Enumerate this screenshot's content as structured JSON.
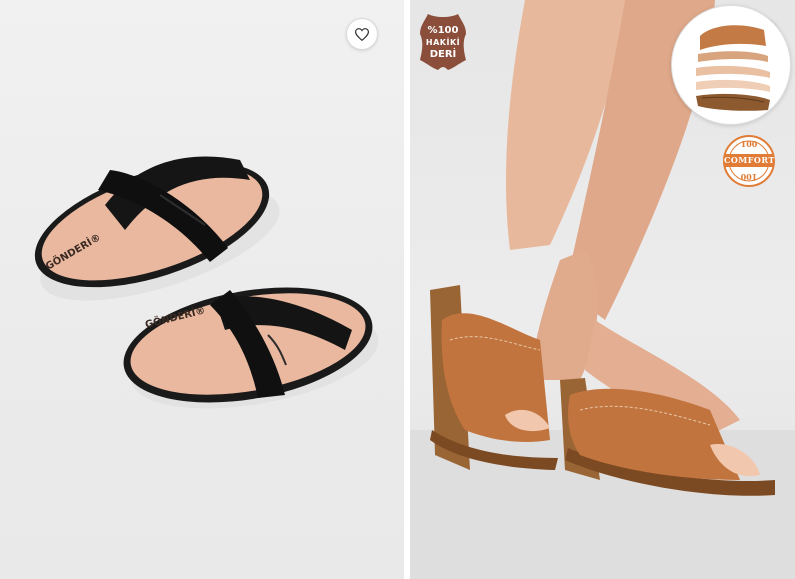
{
  "products": [
    {
      "id_label": "left-card",
      "image_alt": "Black cross-strap flat slide sandals",
      "brand_on_insole": "GÖNDERİ®",
      "favorite_icon": "heart-icon",
      "colors": {
        "strap": "#161616",
        "insole": "#eab9a0",
        "sole": "#1c1c1c"
      }
    },
    {
      "id_label": "right-card",
      "image_alt": "Tan leather wedge slide sandals worn on feet",
      "favorite_icon": "heart-icon",
      "leather_badge": {
        "line1": "%100",
        "line2": "HAKİKİ",
        "line3": "DERİ",
        "color": "#8a4e3b"
      },
      "comfort_badge": {
        "label": "COMFORT",
        "number": "100",
        "color": "#e07c35"
      },
      "colors": {
        "upper": "#c2743e",
        "sole": "#8d5a2f"
      }
    }
  ]
}
